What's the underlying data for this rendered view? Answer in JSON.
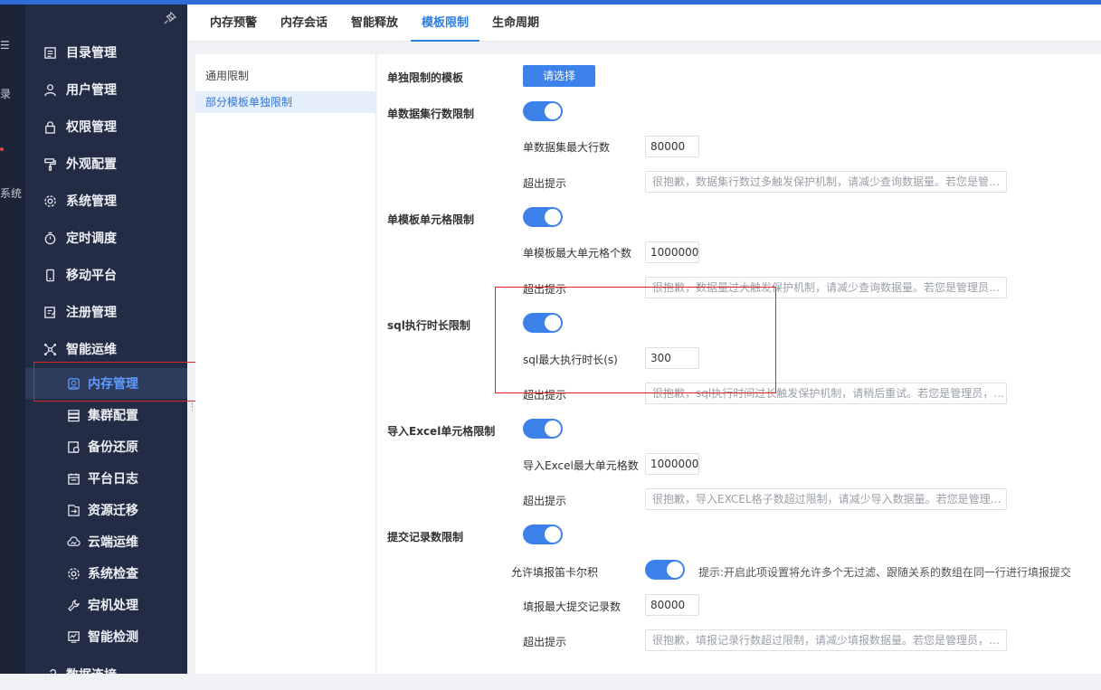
{
  "rail": {
    "glyph_top": "☰",
    "glyph_mid": "录",
    "glyph_bottom": "系统"
  },
  "sidebar": {
    "items": [
      {
        "label": "目录管理"
      },
      {
        "label": "用户管理"
      },
      {
        "label": "权限管理"
      },
      {
        "label": "外观配置"
      },
      {
        "label": "系统管理"
      },
      {
        "label": "定时调度"
      },
      {
        "label": "移动平台"
      },
      {
        "label": "注册管理"
      },
      {
        "label": "智能运维"
      }
    ],
    "sub_items": [
      {
        "label": "内存管理"
      },
      {
        "label": "集群配置"
      },
      {
        "label": "备份还原"
      },
      {
        "label": "平台日志"
      },
      {
        "label": "资源迁移"
      },
      {
        "label": "云端运维"
      },
      {
        "label": "系统检查"
      },
      {
        "label": "宕机处理"
      },
      {
        "label": "智能检测"
      }
    ],
    "bottom_label": "数据连接"
  },
  "tabs": [
    {
      "label": "内存预警"
    },
    {
      "label": "内存会话"
    },
    {
      "label": "智能释放"
    },
    {
      "label": "模板限制"
    },
    {
      "label": "生命周期"
    }
  ],
  "subnav": [
    {
      "label": "通用限制"
    },
    {
      "label": "部分模板单独限制"
    }
  ],
  "content": {
    "template_label": "单独限制的模板",
    "select_button": "请选择",
    "dataset": {
      "label": "单数据集行数限制",
      "max_label": "单数据集最大行数",
      "max_value": "80000",
      "tip_label": "超出提示",
      "tip_value": "很抱歉，数据集行数过多触发保护机制，请减少查询数据量。若您是管理员，请联系系统管理员。"
    },
    "cell": {
      "label": "单模板单元格限制",
      "max_label": "单模板最大单元格个数",
      "max_value": "1000000",
      "tip_label": "超出提示",
      "tip_value": "很抱歉，数据量过大触发保护机制，请减少查询数据量。若您是管理员，请联系系统管理员。"
    },
    "sql": {
      "label": "sql执行时长限制",
      "max_label": "sql最大执行时长(s)",
      "max_value": "300",
      "tip_label": "超出提示",
      "tip_value": "很抱歉，sql执行时间过长触发保护机制，请稍后重试。若您是管理员，请联系系统管理员。"
    },
    "excel": {
      "label": "导入Excel单元格限制",
      "max_label": "导入Excel最大单元格数",
      "max_value": "1000000",
      "tip_label": "超出提示",
      "tip_value": "很抱歉，导入EXCEL格子数超过限制，请减少导入数据量。若您是管理员，请联系系统管理员。"
    },
    "submit": {
      "label": "提交记录数限制",
      "cartesian_label": "允许填报笛卡尔积",
      "cartesian_hint": "提示:开启此项设置将允许多个无过滤、跟随关系的数组在同一行进行填报提交",
      "max_label": "填报最大提交记录数",
      "max_value": "80000",
      "tip_label": "超出提示",
      "tip_value": "很抱歉，填报记录行数超过限制，请减少填报数据量。若您是管理员，请联系系统管理员。"
    }
  },
  "colors": {
    "accent": "#3d82ea",
    "sidebar_bg": "#222c45",
    "highlight_border": "#e02424"
  }
}
